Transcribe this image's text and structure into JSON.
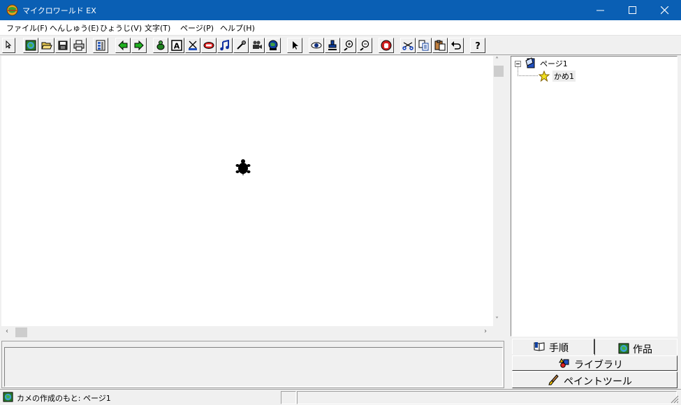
{
  "window": {
    "title": "マイクロワールド EX"
  },
  "menu": {
    "file": "ファイル(F)",
    "edit": "へんしゅう(E)",
    "view": "ひょうじ(V)",
    "text": "文字(T)",
    "page": "ページ(P)",
    "help": "ヘルプ(H)"
  },
  "toolbar": {
    "help_glyph": "?",
    "text_glyph": "A"
  },
  "tree": {
    "page": "ページ1",
    "turtle": "かめ1"
  },
  "tabs": {
    "procedures": "手順",
    "project": "作品",
    "library": "ライブラリ",
    "paint": "ペイントツール"
  },
  "status": {
    "text": "カメの作成のもと: ページ1"
  },
  "colors": {
    "titlebar": "#0a5fb4",
    "canvas": "#ffffff",
    "chrome": "#f0f0f0"
  }
}
